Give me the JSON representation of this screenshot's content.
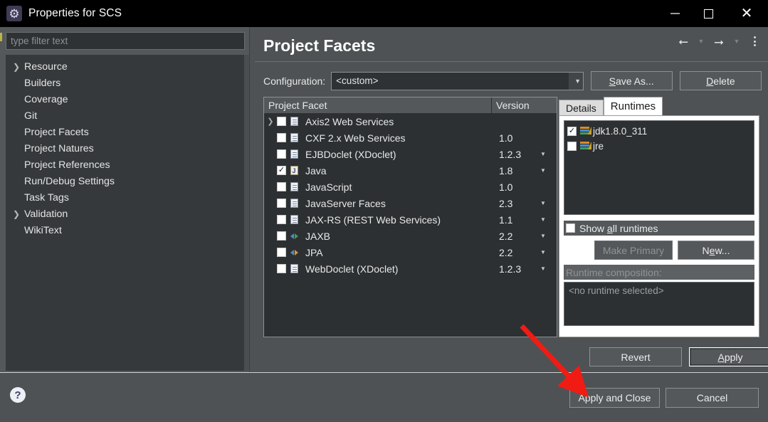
{
  "window": {
    "title": "Properties for SCS",
    "icon": "gear-icon",
    "controls": {
      "minimize": "–",
      "maximize": "▢",
      "close": "✕"
    }
  },
  "sidebar": {
    "filter_placeholder": "type filter text",
    "items": [
      {
        "label": "Resource",
        "expandable": true
      },
      {
        "label": "Builders",
        "expandable": false
      },
      {
        "label": "Coverage",
        "expandable": false
      },
      {
        "label": "Git",
        "expandable": false
      },
      {
        "label": "Project Facets",
        "expandable": false
      },
      {
        "label": "Project Natures",
        "expandable": false
      },
      {
        "label": "Project References",
        "expandable": false
      },
      {
        "label": "Run/Debug Settings",
        "expandable": false
      },
      {
        "label": "Task Tags",
        "expandable": false
      },
      {
        "label": "Validation",
        "expandable": true
      },
      {
        "label": "WikiText",
        "expandable": false
      }
    ]
  },
  "main": {
    "title": "Project Facets",
    "nav": {
      "back": "←",
      "back_menu": "▾",
      "forward": "→",
      "forward_menu": "▾",
      "more": "kebab-menu-icon"
    },
    "configuration": {
      "label": "Configuration:",
      "value": "<custom>",
      "dropdown_arrow": "▾",
      "save_as_label": "Save As...",
      "save_as_mnemonic": "S",
      "delete_label": "Delete",
      "delete_mnemonic": "D"
    },
    "facets_table": {
      "columns": [
        "Project Facet",
        "Version"
      ],
      "rows": [
        {
          "name": "Axis2 Web Services",
          "version": "",
          "checked": false,
          "expandable": true,
          "icon": "document-icon",
          "has_version_dropdown": false
        },
        {
          "name": "CXF 2.x Web Services",
          "version": "1.0",
          "checked": false,
          "expandable": false,
          "icon": "document-icon",
          "has_version_dropdown": false
        },
        {
          "name": "EJBDoclet (XDoclet)",
          "version": "1.2.3",
          "checked": false,
          "expandable": false,
          "icon": "document-icon",
          "has_version_dropdown": true
        },
        {
          "name": "Java",
          "version": "1.8",
          "checked": true,
          "expandable": false,
          "icon": "java-icon",
          "has_version_dropdown": true
        },
        {
          "name": "JavaScript",
          "version": "1.0",
          "checked": false,
          "expandable": false,
          "icon": "document-icon",
          "has_version_dropdown": false
        },
        {
          "name": "JavaServer Faces",
          "version": "2.3",
          "checked": false,
          "expandable": false,
          "icon": "document-icon",
          "has_version_dropdown": true
        },
        {
          "name": "JAX-RS (REST Web Services)",
          "version": "1.1",
          "checked": false,
          "expandable": false,
          "icon": "document-icon",
          "has_version_dropdown": true
        },
        {
          "name": "JAXB",
          "version": "2.2",
          "checked": false,
          "expandable": false,
          "icon": "xml-green-icon",
          "has_version_dropdown": true
        },
        {
          "name": "JPA",
          "version": "2.2",
          "checked": false,
          "expandable": false,
          "icon": "xml-orange-icon",
          "has_version_dropdown": true
        },
        {
          "name": "WebDoclet (XDoclet)",
          "version": "1.2.3",
          "checked": false,
          "expandable": false,
          "icon": "document-icon",
          "has_version_dropdown": true
        }
      ]
    },
    "side_tabs": {
      "tabs": [
        {
          "label": "Details",
          "active": false
        },
        {
          "label": "Runtimes",
          "active": true
        }
      ],
      "runtimes": [
        {
          "label": "jdk1.8.0_311",
          "checked": true
        },
        {
          "label": "jre",
          "checked": false
        }
      ],
      "show_all_label": "Show all runtimes",
      "show_all_mnemonic": "a",
      "show_all_checked": false,
      "make_primary_label": "Make Primary",
      "make_primary_enabled": false,
      "new_label": "New...",
      "new_mnemonic": "e",
      "composition_label": "Runtime composition:",
      "composition_value": "<no runtime selected>"
    },
    "revert_label": "Revert",
    "apply_label": "Apply",
    "apply_mnemonic": "A"
  },
  "footer": {
    "help_icon": "help-icon",
    "apply_and_close_label": "Apply and Close",
    "cancel_label": "Cancel"
  },
  "annotation": {
    "arrow_color": "#f01c14",
    "points_to": "Apply and Close"
  }
}
